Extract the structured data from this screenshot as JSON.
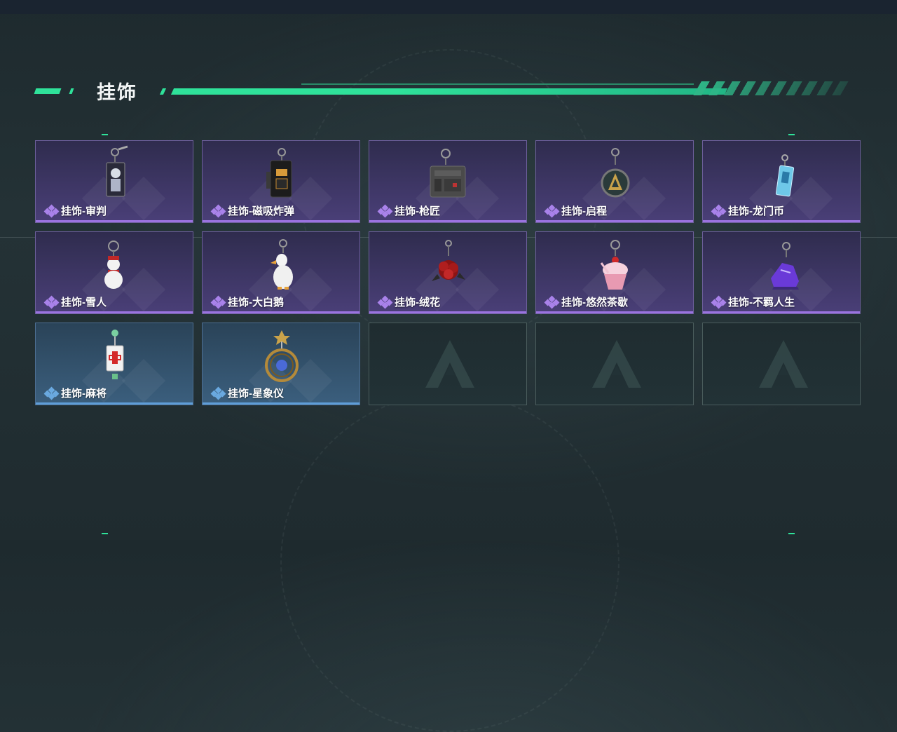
{
  "section": {
    "title": "挂饰"
  },
  "colors": {
    "accent": "#2fe29a",
    "epic": "#9b73e0",
    "rare": "#5f9ed8"
  },
  "items": [
    {
      "name": "挂饰-审判",
      "rarity": "epic",
      "icon": "card-charm-icon"
    },
    {
      "name": "挂饰-磁吸炸弹",
      "rarity": "epic",
      "icon": "magnetic-bomb-charm-icon"
    },
    {
      "name": "挂饰-枪匠",
      "rarity": "epic",
      "icon": "gunsmith-charm-icon"
    },
    {
      "name": "挂饰-启程",
      "rarity": "epic",
      "icon": "medal-charm-icon"
    },
    {
      "name": "挂饰-龙门币",
      "rarity": "epic",
      "icon": "dragon-gate-coin-charm-icon"
    },
    {
      "name": "挂饰-雪人",
      "rarity": "epic",
      "icon": "snowman-charm-icon"
    },
    {
      "name": "挂饰-大白鹅",
      "rarity": "epic",
      "icon": "white-goose-charm-icon"
    },
    {
      "name": "挂饰-绒花",
      "rarity": "epic",
      "icon": "velvet-flower-charm-icon"
    },
    {
      "name": "挂饰-悠然茶歇",
      "rarity": "epic",
      "icon": "cupcake-charm-icon"
    },
    {
      "name": "挂饰-不羁人生",
      "rarity": "epic",
      "icon": "sneaker-charm-icon"
    },
    {
      "name": "挂饰-麻将",
      "rarity": "rare",
      "icon": "mahjong-tile-charm-icon"
    },
    {
      "name": "挂饰-星象仪",
      "rarity": "rare",
      "icon": "astrolabe-charm-icon"
    }
  ],
  "empty_slots": 3
}
